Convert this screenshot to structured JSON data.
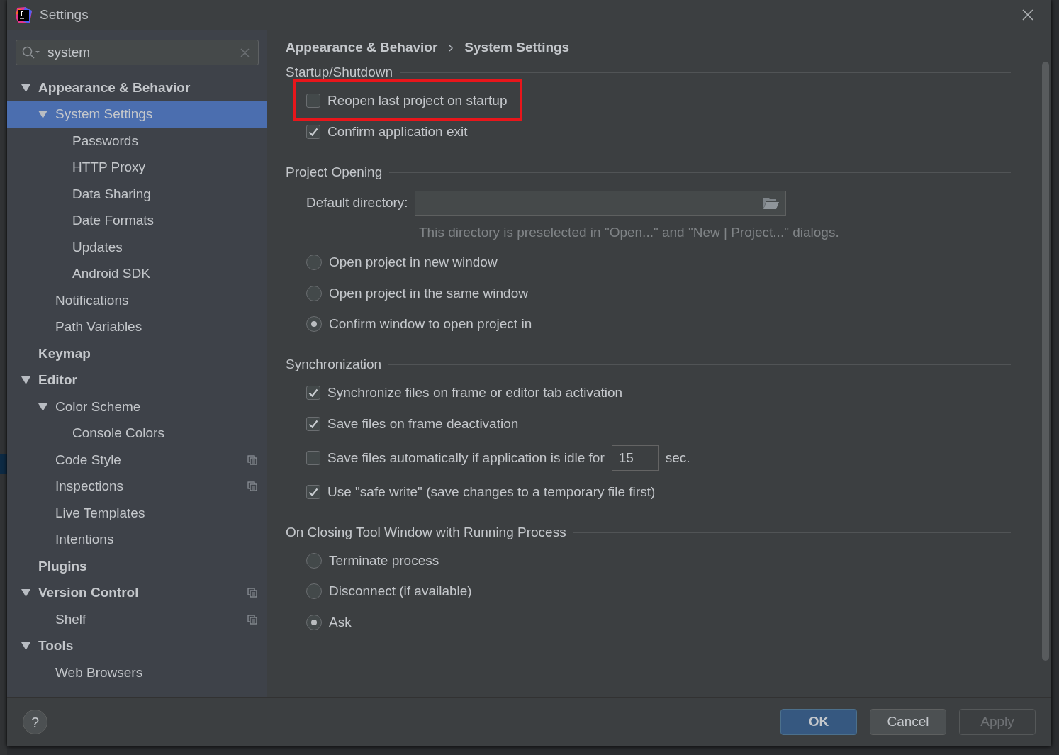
{
  "window": {
    "title": "Settings"
  },
  "search": {
    "value": "system"
  },
  "tree": [
    {
      "label": "Appearance & Behavior",
      "expanded": true,
      "selected": false,
      "scope_icon": false,
      "children": [
        {
          "label": "System Settings",
          "expanded": true,
          "selected": true,
          "scope_icon": false,
          "children": [
            {
              "label": "Passwords",
              "selected": false,
              "scope_icon": false
            },
            {
              "label": "HTTP Proxy",
              "selected": false,
              "scope_icon": false
            },
            {
              "label": "Data Sharing",
              "selected": false,
              "scope_icon": false
            },
            {
              "label": "Date Formats",
              "selected": false,
              "scope_icon": false
            },
            {
              "label": "Updates",
              "selected": false,
              "scope_icon": false
            },
            {
              "label": "Android SDK",
              "selected": false,
              "scope_icon": false
            }
          ]
        },
        {
          "label": "Notifications",
          "selected": false,
          "scope_icon": false
        },
        {
          "label": "Path Variables",
          "selected": false,
          "scope_icon": false
        }
      ]
    },
    {
      "label": "Keymap",
      "selected": false,
      "scope_icon": false
    },
    {
      "label": "Editor",
      "expanded": true,
      "selected": false,
      "scope_icon": false,
      "children": [
        {
          "label": "Color Scheme",
          "expanded": true,
          "selected": false,
          "scope_icon": false,
          "children": [
            {
              "label": "Console Colors",
              "selected": false,
              "scope_icon": false
            }
          ]
        },
        {
          "label": "Code Style",
          "selected": false,
          "scope_icon": true
        },
        {
          "label": "Inspections",
          "selected": false,
          "scope_icon": true
        },
        {
          "label": "Live Templates",
          "selected": false,
          "scope_icon": false
        },
        {
          "label": "Intentions",
          "selected": false,
          "scope_icon": false
        }
      ]
    },
    {
      "label": "Plugins",
      "selected": false,
      "scope_icon": false
    },
    {
      "label": "Version Control",
      "expanded": true,
      "selected": false,
      "scope_icon": true,
      "children": [
        {
          "label": "Shelf",
          "selected": false,
          "scope_icon": true
        }
      ]
    },
    {
      "label": "Tools",
      "expanded": true,
      "selected": false,
      "scope_icon": false,
      "children": [
        {
          "label": "Web Browsers",
          "selected": false,
          "scope_icon": false
        }
      ]
    }
  ],
  "breadcrumb": [
    "Appearance & Behavior",
    "System Settings"
  ],
  "sections": [
    {
      "title": "Startup/Shutdown",
      "items": [
        {
          "kind": "checkbox",
          "label": "Reopen last project on startup",
          "checked": false,
          "highlighted": true
        },
        {
          "kind": "checkbox",
          "label": "Confirm application exit",
          "checked": true,
          "highlighted": false
        }
      ]
    },
    {
      "title": "Project Opening",
      "items": [
        {
          "kind": "directory",
          "label": "Default directory:",
          "hint": "This directory is preselected in \"Open...\" and \"New | Project...\" dialogs."
        },
        {
          "kind": "radio",
          "label": "Open project in new window",
          "selected": false
        },
        {
          "kind": "radio",
          "label": "Open project in the same window",
          "selected": false
        },
        {
          "kind": "radio",
          "label": "Confirm window to open project in",
          "selected": true
        }
      ]
    },
    {
      "title": "Synchronization",
      "items": [
        {
          "kind": "checkbox",
          "label": "Synchronize files on frame or editor tab activation",
          "checked": true,
          "highlighted": false
        },
        {
          "kind": "checkbox",
          "label": "Save files on frame deactivation",
          "checked": true,
          "highlighted": false
        },
        {
          "kind": "number",
          "label": "Save files automatically if application is idle for",
          "checked": false,
          "value": "15",
          "unit": "sec."
        },
        {
          "kind": "checkbox",
          "label": "Use \"safe write\" (save changes to a temporary file first)",
          "checked": true,
          "highlighted": false
        }
      ]
    },
    {
      "title": "On Closing Tool Window with Running Process",
      "items": [
        {
          "kind": "radio",
          "label": "Terminate process",
          "selected": false
        },
        {
          "kind": "radio",
          "label": "Disconnect (if available)",
          "selected": false
        },
        {
          "kind": "radio",
          "label": "Ask",
          "selected": true
        }
      ]
    }
  ],
  "help": {
    "label": "?"
  },
  "buttons": [
    {
      "label": "OK",
      "default": true,
      "disabled": false
    },
    {
      "label": "Cancel",
      "default": false,
      "disabled": false
    },
    {
      "label": "Apply",
      "default": false,
      "disabled": true
    }
  ]
}
